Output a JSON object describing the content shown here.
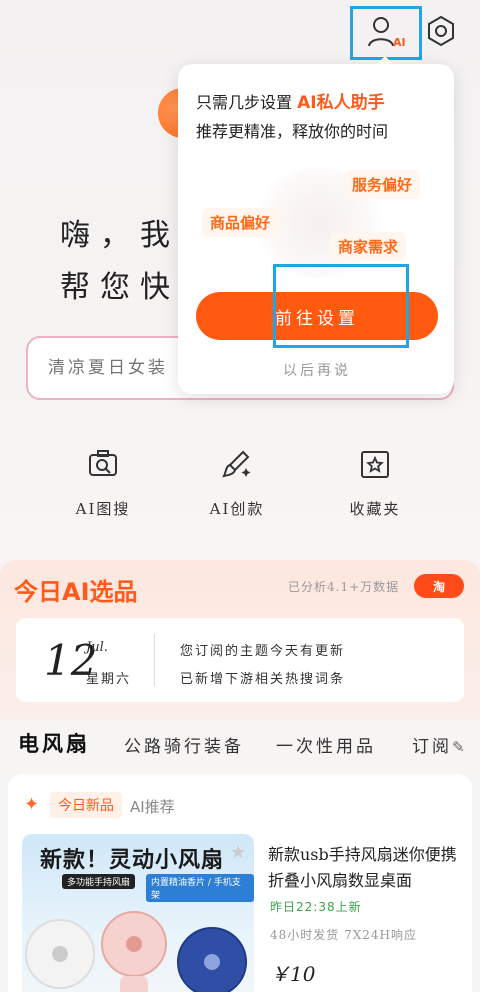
{
  "greeting": {
    "line1": "嗨，我是",
    "line2": "帮您快速"
  },
  "search": {
    "placeholder": "清凉夏日女装"
  },
  "tools": [
    {
      "label": "AI图搜",
      "icon": "camera-search-icon"
    },
    {
      "label": "AI创款",
      "icon": "brush-sparkle-icon"
    },
    {
      "label": "收藏夹",
      "icon": "star-folder-icon"
    }
  ],
  "header": {
    "ai_icon": "ai-user-icon",
    "settings_icon": "hexagon-settings-icon",
    "ai_badge": "AI"
  },
  "popup": {
    "line1_prefix": "只需几步设置",
    "line1_highlight": "AI私人助手",
    "line2": "推荐更精准，释放你的时间",
    "prefs": [
      "服务偏好",
      "商品偏好",
      "商家需求"
    ],
    "goto_label": "前往设置",
    "later_label": "以后再说"
  },
  "today": {
    "title": "今日AI选品",
    "analyzed": "已分析4.1+万数据",
    "logo_text": "淘",
    "date_day": "12",
    "date_month": "Jul.",
    "date_week": "星期六",
    "line1": "您订阅的主题今天有更新",
    "line2": "已新增下游相关热搜词条"
  },
  "topics": {
    "items": [
      "电风扇",
      "公路骑行装备",
      "一次性用品"
    ],
    "subscribe_label": "订阅"
  },
  "product": {
    "badge_new": "今日新品",
    "ai_rec": "AI推荐",
    "image_title": "新款！灵动小风扇",
    "image_sub1": "多功能手持风扇",
    "image_sub2": "内置精油香片 / 手机支架",
    "title": "新款usb手持风扇迷你便携折叠小风扇数显桌面",
    "time": "昨日22:38上新",
    "shipping": "48小时发货  7X24H响应",
    "price": "￥10"
  },
  "colors": {
    "accent": "#ff5a0f",
    "highlight_border": "#20a6e4",
    "green": "#3aa44a"
  }
}
